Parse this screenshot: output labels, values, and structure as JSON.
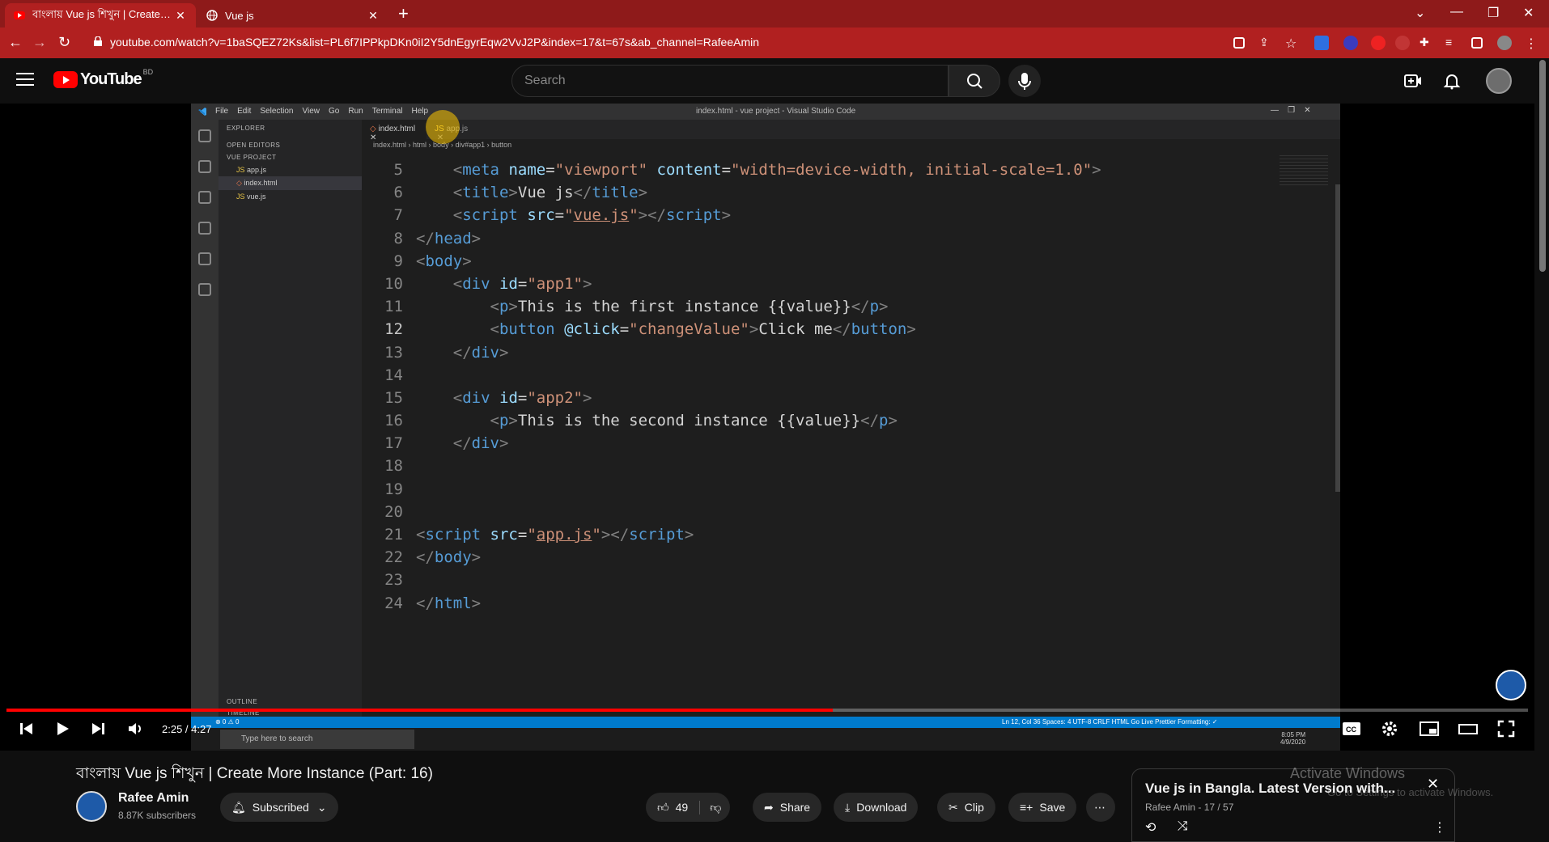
{
  "browser": {
    "tabs": [
      {
        "title": "বাংলায় Vue js শিখুন | Create More",
        "favicon": "youtube-icon"
      },
      {
        "title": "Vue js",
        "favicon": "globe-icon"
      }
    ],
    "new_tab": "+",
    "url": "youtube.com/watch?v=1baSQEZ72Ks&list=PL6f7IPPkpDKn0iI2Y5dnEgyrEqw2VvJ2P&index=17&t=67s&ab_channel=RafeeAmin",
    "accent_color": "#b12020"
  },
  "youtube": {
    "logo_text": "YouTube",
    "country_code": "BD",
    "search_placeholder": "Search"
  },
  "vscode": {
    "menu": [
      "File",
      "Edit",
      "Selection",
      "View",
      "Go",
      "Run",
      "Terminal",
      "Help"
    ],
    "window_title": "index.html - vue project - Visual Studio Code",
    "explorer": "EXPLORER",
    "open_editors": "OPEN EDITORS",
    "project": "VUE PROJECT",
    "files": [
      "app.js",
      "index.html",
      "vue.js"
    ],
    "outline": "OUTLINE",
    "timeline": "TIMELINE",
    "tabs": [
      "index.html",
      "app.js"
    ],
    "breadcrumb": [
      "index.html",
      "html",
      "body",
      "div#app1",
      "button"
    ],
    "status_left": "⊗ 0 ⚠ 0",
    "status_right": "Ln 12, Col 36   Spaces: 4   UTF-8   CRLF   HTML   Go Live   Prettier   Formatting: ✓",
    "taskbar_search": "Type here to search",
    "taskbar_time": "8:05 PM",
    "taskbar_date": "4/9/2020",
    "line_numbers": [
      "5",
      "6",
      "7",
      "8",
      "9",
      "10",
      "11",
      "12",
      "13",
      "14",
      "15",
      "16",
      "17",
      "18",
      "19",
      "20",
      "21",
      "22",
      "23",
      "24"
    ]
  },
  "player": {
    "time": "2:25 / 4:27",
    "progress": 0.543
  },
  "video": {
    "title": "বাংলায় Vue js শিখুন | Create More Instance (Part: 16)",
    "channel": "Rafee Amin",
    "subscribers": "8.87K subscribers",
    "subscribe_label": "Subscribed",
    "likes": "49",
    "share": "Share",
    "download": "Download",
    "clip": "Clip",
    "save": "Save"
  },
  "playlist": {
    "title": "Vue js in Bangla. Latest Version with...",
    "meta": "Rafee Amin - 17 / 57"
  },
  "overlay": {
    "activate_windows": "Activate Windows",
    "activate_sub": "Go to Settings to activate Windows."
  }
}
